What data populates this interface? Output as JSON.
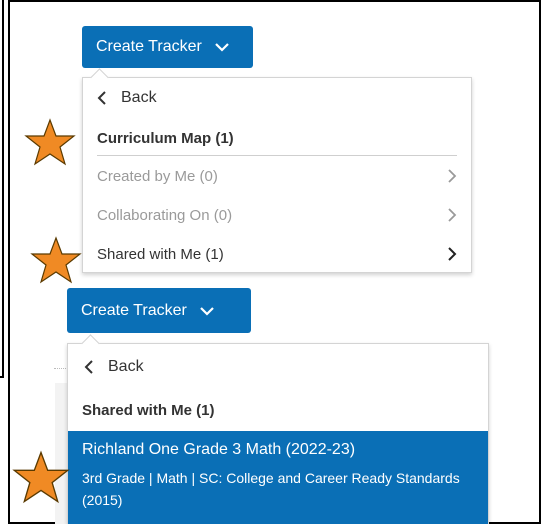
{
  "top_dropdown": {
    "button_label": "Create Tracker",
    "back_label": "Back",
    "heading": "Curriculum Map (1)",
    "items": [
      {
        "label": "Created by Me (0)",
        "enabled": false
      },
      {
        "label": "Collaborating On (0)",
        "enabled": false
      },
      {
        "label": "Shared with Me (1)",
        "enabled": true
      }
    ]
  },
  "bottom_dropdown": {
    "button_label": "Create Tracker",
    "back_label": "Back",
    "heading": "Shared with Me (1)",
    "selected_item": {
      "title": "Richland One Grade 3 Math (2022-23)",
      "subtitle": "3rd Grade | Math | SC: College and Career Ready Standards (2015)"
    }
  },
  "colors": {
    "accent": "#0a6fb6",
    "star": "#f08a24",
    "star_outline": "#5a3a00",
    "disabled_text": "#9a9a9a"
  },
  "icons": [
    "chevron-down-icon",
    "chevron-left-icon",
    "chevron-right-icon",
    "star-icon"
  ]
}
